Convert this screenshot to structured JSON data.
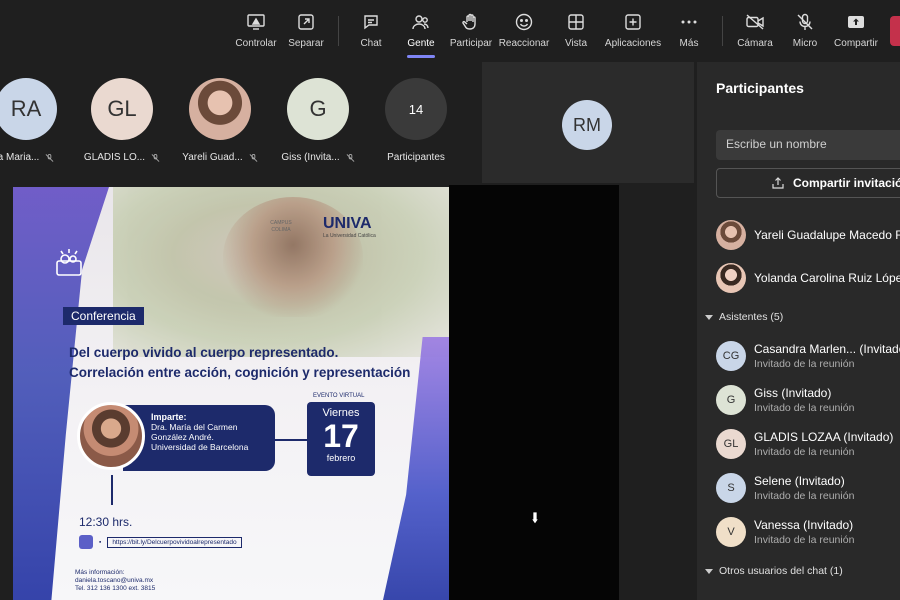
{
  "toolbar": {
    "controlar": "Controlar",
    "separar": "Separar",
    "chat": "Chat",
    "gente": "Gente",
    "participar": "Participar",
    "reaccionar": "Reaccionar",
    "vista": "Vista",
    "aplicaciones": "Aplicaciones",
    "mas": "Más",
    "camara": "Cámara",
    "micro": "Micro",
    "compartir": "Compartir"
  },
  "strip": [
    {
      "initials": "RA",
      "name": "a Maria...",
      "color": "#c9d6e8"
    },
    {
      "initials": "GL",
      "name": "GLADIS LO...",
      "color": "#ead9d0"
    },
    {
      "initials": "",
      "name": "Yareli Guad...",
      "color": "#e7c2b0"
    },
    {
      "initials": "G",
      "name": "Giss (Invita...",
      "color": "#dde3d5"
    },
    {
      "initials": "14",
      "name": "Participantes",
      "color": "#3a3a3a"
    }
  ],
  "spotlight": {
    "initials": "RM"
  },
  "poster": {
    "campus": "CAMPUS COLIMA",
    "brand": "UNIVA",
    "brand_sub": "La Universidad Católica",
    "badge": "Conferencia",
    "title_line1": "Del cuerpo vivido al cuerpo representado.",
    "title_line2": "Correlación entre acción, cognición y representación",
    "imparte": "Imparte:",
    "speaker_line1": "Dra. María del Carmen",
    "speaker_line2": "González André.",
    "speaker_line3": "Universidad de Barcelona",
    "event_type": "EVENTO VIRTUAL",
    "day": "Viernes",
    "date": "17",
    "month": "febrero",
    "time": "12:30 hrs.",
    "link": "https://bit.ly/Delcuerpovividoalrepresentado",
    "info_label": "Más información:",
    "info_email": "daniela.toscano@univa.mx",
    "info_phone": "Tel. 312 136 1300 ext. 3815"
  },
  "panel": {
    "title": "Participantes",
    "search_placeholder": "Escribe un nombre",
    "share_label": "Compartir invitación",
    "presenters": [
      {
        "name": "Yareli Guadalupe Macedo R"
      },
      {
        "name": "Yolanda Carolina Ruiz Lópe"
      }
    ],
    "attendees_header": "Asistentes (5)",
    "attendees": [
      {
        "initials": "CG",
        "name": "Casandra Marlen... (Invitado",
        "sub": "Invitado de la reunión",
        "color": "#c9d6e8"
      },
      {
        "initials": "G",
        "name": "Giss (Invitado)",
        "sub": "Invitado de la reunión",
        "color": "#dde3d5"
      },
      {
        "initials": "GL",
        "name": "GLADIS LOZAA (Invitado)",
        "sub": "Invitado de la reunión",
        "color": "#ead9d0"
      },
      {
        "initials": "S",
        "name": "Selene (Invitado)",
        "sub": "Invitado de la reunión",
        "color": "#c9d6e8"
      },
      {
        "initials": "V",
        "name": "Vanessa (Invitado)",
        "sub": "Invitado de la reunión",
        "color": "#f0dfc8"
      }
    ],
    "others_header": "Otros usuarios del chat (1)"
  }
}
